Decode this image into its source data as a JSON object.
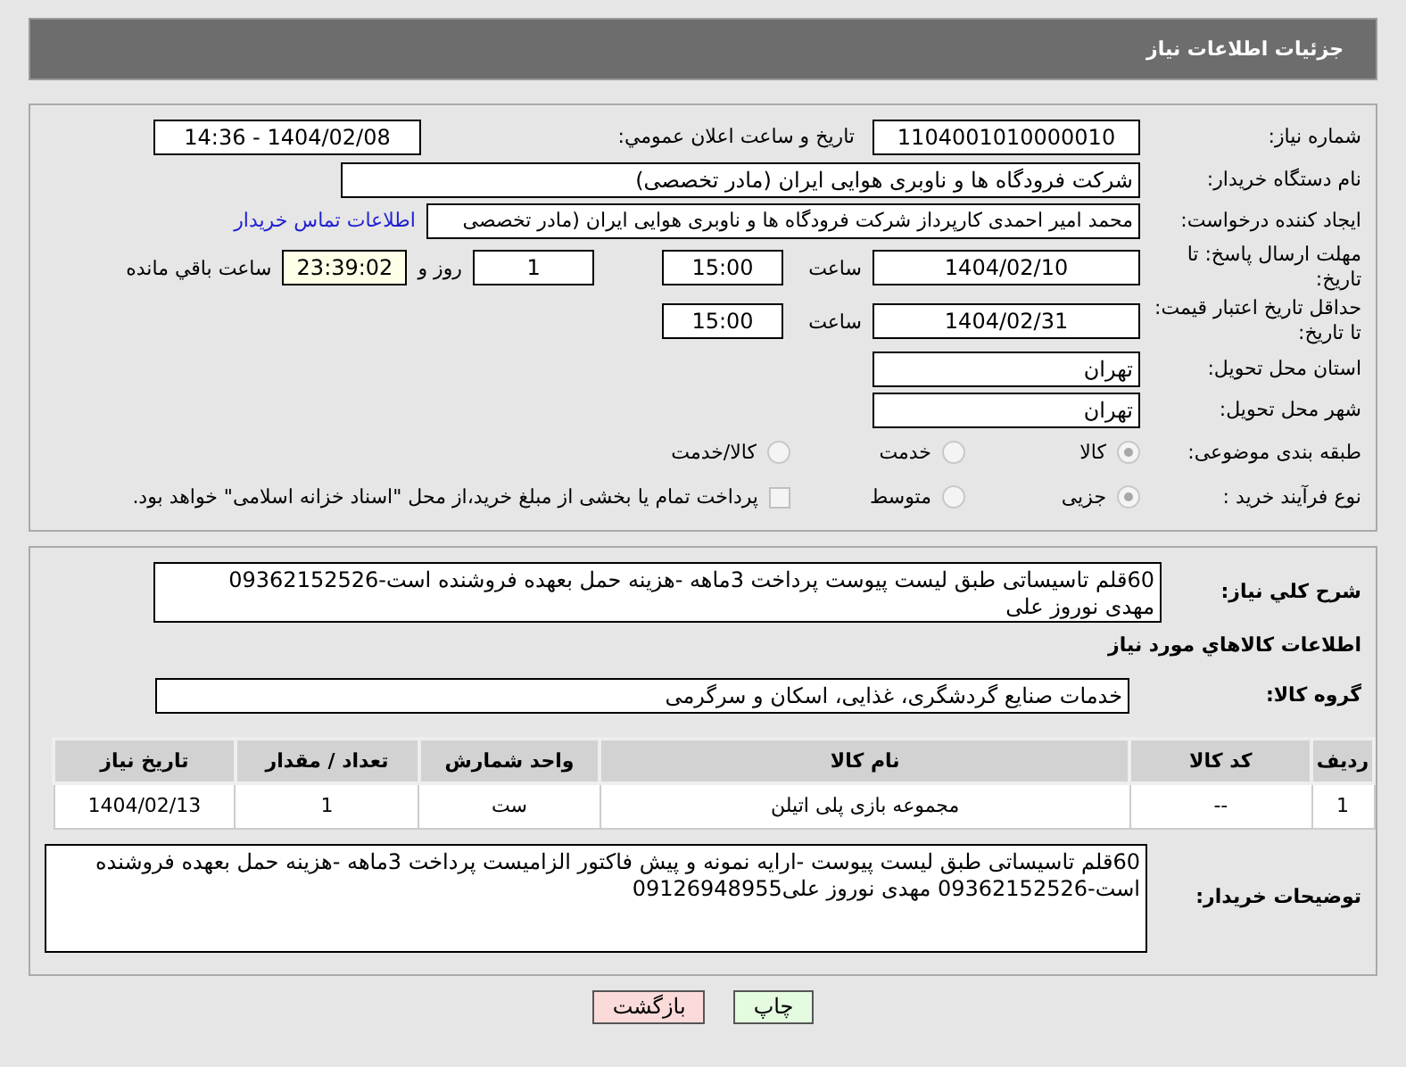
{
  "header": {
    "title": "جزئیات اطلاعات نیاز"
  },
  "need_number": {
    "label": "شماره نیاز:",
    "value": "1104001010000010"
  },
  "announce": {
    "label": "تاریخ و ساعت اعلان عمومي:",
    "value": "1404/02/08 - 14:36"
  },
  "buyer": {
    "label": "نام دستگاه خریدار:",
    "value": "شرکت فرودگاه ها و ناوبری هوایی ایران (مادر تخصصی)"
  },
  "creator": {
    "label": "ایجاد کننده درخواست:",
    "value": "محمد امیر احمدی کارپرداز شرکت فرودگاه ها و ناوبری هوایی ایران (مادر تخصصی",
    "link": "اطلاعات تماس خریدار"
  },
  "deadline": {
    "label": "مهلت ارسال پاسخ: تا تاریخ:",
    "date": "1404/02/10",
    "time_label": "ساعت",
    "time": "15:00",
    "days": "1",
    "days_label": "روز و",
    "remaining": "23:39:02",
    "remaining_label": "ساعت باقي مانده"
  },
  "validity": {
    "label": "حداقل تاریخ اعتبار قیمت: تا تاریخ:",
    "date": "1404/02/31",
    "time_label": "ساعت",
    "time": "15:00"
  },
  "province": {
    "label": "استان محل تحویل:",
    "value": "تهران"
  },
  "city": {
    "label": "شهر محل تحویل:",
    "value": "تهران"
  },
  "category": {
    "label": "طبقه بندی موضوعی:",
    "options": [
      {
        "label": "کالا",
        "selected": true
      },
      {
        "label": "خدمت",
        "selected": false
      },
      {
        "label": "کالا/خدمت",
        "selected": false
      }
    ]
  },
  "process": {
    "label": "نوع فرآیند خرید :",
    "options": [
      {
        "label": "جزیی",
        "selected": true
      },
      {
        "label": "متوسط",
        "selected": false
      }
    ],
    "treasury": {
      "checked": false,
      "label": "پرداخت تمام یا بخشی از مبلغ خرید،از محل \"اسناد خزانه اسلامی\" خواهد بود."
    }
  },
  "description": {
    "label": "شرح کلي نیاز:",
    "lines": [
      "60قلم تاسیساتی طبق لیست پیوست پرداخت 3ماهه -هزینه حمل بعهده فروشنده است-09362152526",
      "مهدی نوروز علی"
    ]
  },
  "goods_heading": "اطلاعات کالاهاي مورد نیاز",
  "goods_group": {
    "label": "گروه کالا:",
    "value": "خدمات صنایع گردشگری، غذایی، اسکان و سرگرمی"
  },
  "table": {
    "columns": [
      "ردیف",
      "کد کالا",
      "نام کالا",
      "واحد شمارش",
      "تعداد / مقدار",
      "تاریخ نیاز"
    ],
    "rows": [
      [
        "1",
        "--",
        "مجموعه بازی پلی اتیلن",
        "ست",
        "1",
        "1404/02/13"
      ]
    ]
  },
  "buyer_notes": {
    "label": "توضیحات خریدار:",
    "lines": [
      "60قلم تاسیساتی طبق لیست پیوست -ارایه نمونه و پیش فاکتور الزامیست پرداخت 3ماهه -هزینه حمل بعهده فروشنده",
      "است-09362152526 مهدی نوروز علی09126948955"
    ]
  },
  "buttons": [
    {
      "kind": "print",
      "label": "چاپ"
    },
    {
      "kind": "back",
      "label": "بازگشت"
    }
  ]
}
